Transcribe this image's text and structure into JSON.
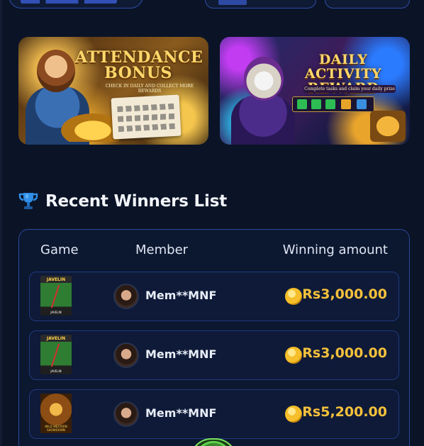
{
  "banners": [
    {
      "title": "ATTENDANCE BONUS",
      "subtitle": "CHECK IN DAILY AND COLLECT MORE REWARDS"
    },
    {
      "title": "DAILY ACTIVITY REWARD",
      "subtitle": "Complete tasks and claim your daily prize"
    }
  ],
  "winners_section": {
    "title": "Recent Winners List",
    "columns": {
      "game": "Game",
      "member": "Member",
      "amount": "Winning amount"
    },
    "rows": [
      {
        "game_label": "JAVELIN",
        "game_footer": "JAVELIN",
        "member": "Mem**MNF",
        "amount": "Rs3,000.00"
      },
      {
        "game_label": "JAVELIN",
        "game_footer": "JAVELIN",
        "member": "Mem**MNF",
        "amount": "Rs3,000.00"
      },
      {
        "game_label": "",
        "game_footer": "WILD WESTERN SHOWDOWN",
        "member": "Mem**MNF",
        "amount": "Rs5,200.00"
      }
    ]
  },
  "colors": {
    "background": "#0b1326",
    "accent_border": "#2c4a9a",
    "amount_gold": "#f6c13b"
  },
  "icons": {
    "section": "trophy-icon",
    "amount": "coin-icon"
  }
}
